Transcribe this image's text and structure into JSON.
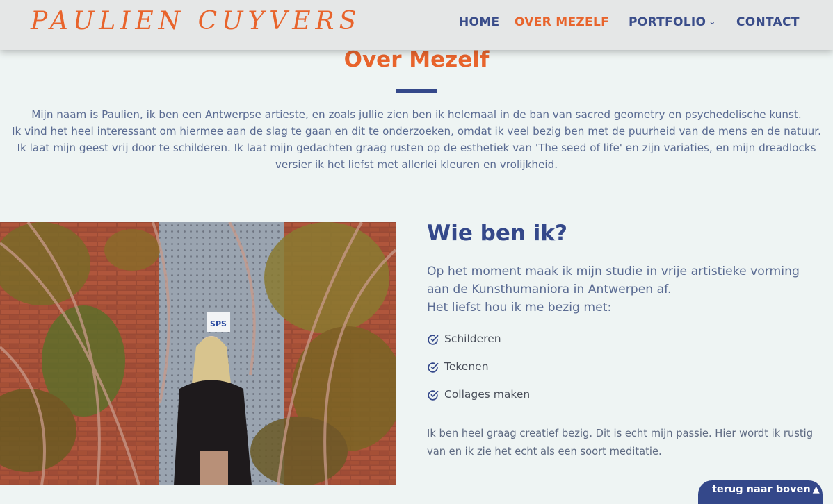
{
  "header": {
    "logo_text": "PAULIEN CUYVERS",
    "nav": [
      {
        "label": "HOME",
        "active": false
      },
      {
        "label": "OVER MEZELF",
        "active": true
      },
      {
        "label": "PORTFOLIO",
        "active": false,
        "has_dropdown": true
      },
      {
        "label": "CONTACT",
        "active": false
      }
    ]
  },
  "intro": {
    "title": "Over Mezelf",
    "lines": [
      "Mijn naam is Paulien, ik ben een Antwerpse artieste, en zoals jullie zien ben ik helemaal in de ban van sacred geometry en psychedelische kunst.",
      "Ik vind het heel interessant om hiermee aan de slag te gaan en dit te onderzoeken, omdat ik veel bezig ben met de puurheid van de mens en de natuur.",
      "Ik laat mijn geest vrij door te schilderen. Ik laat mijn gedachten graag rusten op de esthetiek van 'The seed of life' en zijn variaties, en mijn dreadlocks versier ik het liefst met allerlei kleuren en vrolijkheid."
    ]
  },
  "photo": {
    "sign_text": "SPS"
  },
  "about": {
    "title": "Wie ben ik?",
    "line1": "Op het moment maak ik mijn studie in vrije artistieke vorming aan de Kunsthumaniora in Antwerpen af.",
    "line2": "Het liefst hou ik me bezig met:",
    "items": [
      "Schilderen",
      "Tekenen",
      "Collages maken"
    ],
    "outro": "Ik ben heel graag creatief bezig. Dit is echt mijn passie. Hier wordt ik rustig van en ik zie het echt als een soort meditatie."
  },
  "back_to_top": {
    "label": "terug naar boven"
  },
  "colors": {
    "accent": "#e8642c",
    "primary": "#34488a",
    "background": "#eef4f3",
    "header_bg": "#e5e7e7"
  }
}
